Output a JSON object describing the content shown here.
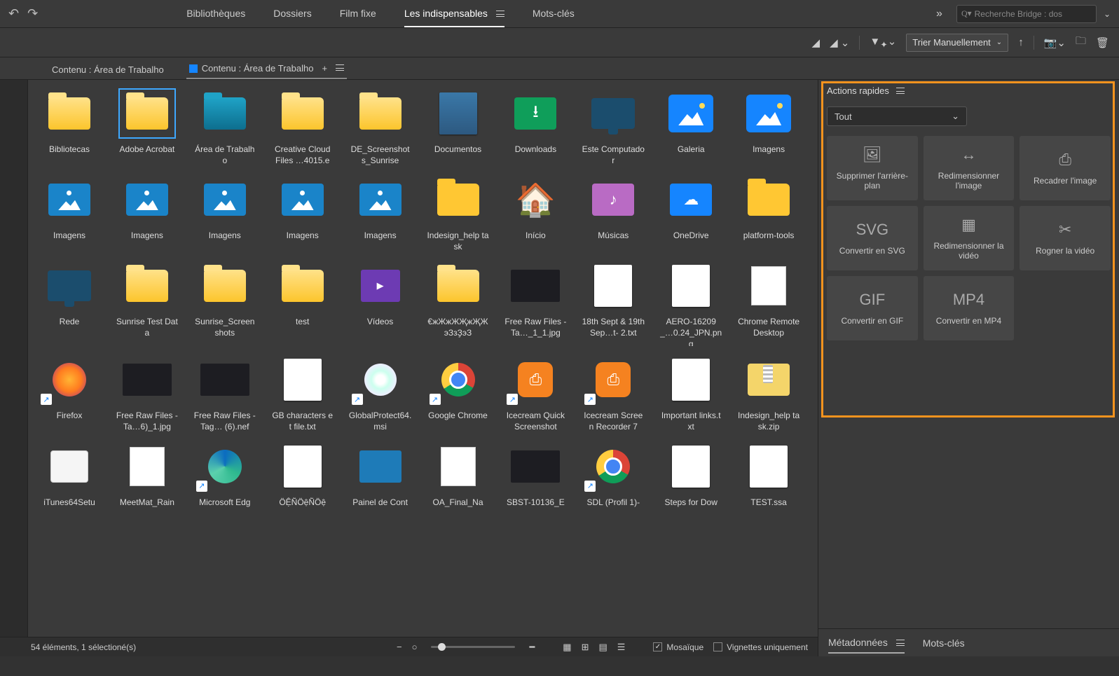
{
  "topbar": {
    "tabs": [
      "Bibliothèques",
      "Dossiers",
      "Film fixe",
      "Les indispensables",
      "Mots-clés"
    ],
    "active_tab_index": 3,
    "search_placeholder": "Recherche Bridge : dos"
  },
  "toolbar": {
    "sort_label": "Trier Manuellement"
  },
  "content_tabs": {
    "tab1": "Contenu : Área de Trabalho",
    "tab2": "Contenu : Área de Trabalho"
  },
  "grid": {
    "selected_index": 1,
    "items": [
      {
        "l": "Bibliotecas",
        "t": "folder-yellow"
      },
      {
        "l": "Adobe Acrobat",
        "t": "folder-yellow"
      },
      {
        "l": "Área de Trabalho",
        "t": "folder-blue"
      },
      {
        "l": "Creative Cloud Files …4015.e",
        "t": "folder-yellow"
      },
      {
        "l": "DE_Screenshots_Sunrise",
        "t": "folder-yellow"
      },
      {
        "l": "Documentos",
        "t": "doc-blue"
      },
      {
        "l": "Downloads",
        "t": "download"
      },
      {
        "l": "Este Computador",
        "t": "monitor"
      },
      {
        "l": "Galeria",
        "t": "img-tile"
      },
      {
        "l": "Imagens",
        "t": "img-tile"
      },
      {
        "l": "Imagens",
        "t": "folder-img"
      },
      {
        "l": "Imagens",
        "t": "folder-img"
      },
      {
        "l": "Imagens",
        "t": "folder-img"
      },
      {
        "l": "Imagens",
        "t": "folder-img"
      },
      {
        "l": "Imagens",
        "t": "folder-img"
      },
      {
        "l": "Indesign_help task",
        "t": "folder-plain-yellow"
      },
      {
        "l": "Início",
        "t": "house"
      },
      {
        "l": "Músicas",
        "t": "music"
      },
      {
        "l": "OneDrive",
        "t": "cloud"
      },
      {
        "l": "platform-tools",
        "t": "folder-plain-yellow"
      },
      {
        "l": "Rede",
        "t": "monitor-net"
      },
      {
        "l": "Sunrise Test Data",
        "t": "folder-yellow"
      },
      {
        "l": "Sunrise_Screenshots",
        "t": "folder-yellow"
      },
      {
        "l": "test",
        "t": "folder-yellow"
      },
      {
        "l": "Vídeos",
        "t": "video"
      },
      {
        "l": "€жЖжЖҖжҖЖэЗзҘэЗ",
        "t": "folder-yellow"
      },
      {
        "l": "Free Raw Files - Ta…_1_1.jpg",
        "t": "dark"
      },
      {
        "l": "18th Sept & 19th Sep…t- 2.txt",
        "t": "doc"
      },
      {
        "l": "AERO-16209_…0.24_JPN.png",
        "t": "doc"
      },
      {
        "l": "Chrome Remote Desktop",
        "t": "chrome-stack"
      },
      {
        "l": "Firefox",
        "t": "firefox",
        "sc": true
      },
      {
        "l": "Free Raw Files - Ta…6)_1.jpg",
        "t": "dark",
        "cr": true
      },
      {
        "l": "Free Raw Files - Tag… (6).nef",
        "t": "dark"
      },
      {
        "l": "GB characters et file.txt",
        "t": "doc"
      },
      {
        "l": "GlobalProtect64.msi",
        "t": "cd",
        "sc": true
      },
      {
        "l": "Google Chrome",
        "t": "chrome",
        "sc": true
      },
      {
        "l": "Icecream Quick Screenshot",
        "t": "orange",
        "sc": true
      },
      {
        "l": "Icecream Screen Recorder 7",
        "t": "orange",
        "sc": true
      },
      {
        "l": "Important links.txt",
        "t": "doc"
      },
      {
        "l": "Indesign_help task.zip",
        "t": "zip"
      },
      {
        "l": "iTunes64Setu",
        "t": "box"
      },
      {
        "l": "MeetMat_Rain",
        "t": "stacked"
      },
      {
        "l": "Microsoft Edg",
        "t": "edge",
        "sc": true
      },
      {
        "l": "ÖỆÑÖệÑÖệ",
        "t": "doc"
      },
      {
        "l": "Painel de Cont",
        "t": "slide"
      },
      {
        "l": "OA_Final_Na",
        "t": "stacked"
      },
      {
        "l": "SBST-10136_E",
        "t": "dark"
      },
      {
        "l": "SDL (Profil 1)-",
        "t": "chrome",
        "sc": true
      },
      {
        "l": "Steps for Dow",
        "t": "doc"
      },
      {
        "l": "TEST.ssa",
        "t": "doc"
      }
    ]
  },
  "quick_actions": {
    "title": "Actions rapides",
    "dropdown": "Tout",
    "items": [
      "Supprimer l'arrière-plan",
      "Redimensionner l'image",
      "Recadrer l'image",
      "Convertir en SVG",
      "Redimensionner la vidéo",
      "Rogner la vidéo",
      "Convertir en GIF",
      "Convertir en MP4"
    ]
  },
  "metadata_tabs": {
    "tab1": "Métadonnées",
    "tab2": "Mots-clés"
  },
  "statusbar": {
    "count": "54 éléments, 1 sélectioné(s)",
    "mosaic": "Mosaïque",
    "thumbs_only": "Vignettes uniquement"
  }
}
